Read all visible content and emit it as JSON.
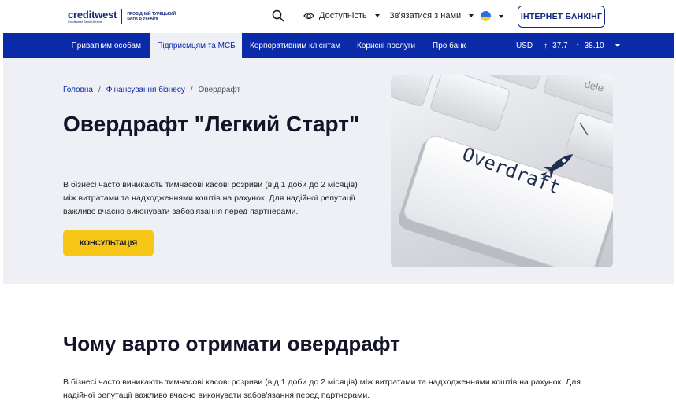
{
  "header": {
    "logo_word": "creditwest",
    "logo_sub": "Creditwest Bank Ukraine",
    "logo_tagline": "ПРОВІДНИЙ ТУРЕЦЬКИЙ БАНК В УКРАЇНІ",
    "accessibility_label": "Доступність",
    "contact_label": "Зв'язатися з нами",
    "internet_banking_label": "ІНТЕРНЕТ БАНКІНГ"
  },
  "nav": {
    "items": [
      {
        "label": "Приватним особам"
      },
      {
        "label": "Підприємцям та МСБ"
      },
      {
        "label": "Корпоративним клієнтам"
      },
      {
        "label": "Корисні послуги"
      },
      {
        "label": "Про банк"
      }
    ],
    "active_index": 1,
    "currency": "USD",
    "rate_buy": "37.7",
    "rate_sell": "38.10"
  },
  "breadcrumb": {
    "home": "Головна",
    "section": "Фінансування бізнесу",
    "current": "Овердрафт"
  },
  "hero": {
    "title": "Овердрафт \"Легкий Старт\"",
    "text": "В бізнесі часто виникають тимчасові касові розриви (від 1 доби до 2 місяців) між витратами та надходженнями коштів на рахунок. Для надійної репутації важливо вчасно виконувати забов'язання перед партнерами.",
    "button_label": "КОНСУЛЬТАЦІЯ",
    "image_key_text": "Overdraft",
    "image_corner_text": "dele"
  },
  "section": {
    "title": "Чому варто отримати овердрафт",
    "text": "В бізнесі часто виникають тимчасові касові розриви (від 1 доби до 2 місяців) між витратами та надходженнями коштів на рахунок. Для надійної репутації важливо вчасно виконувати забов'язання перед партнерами."
  },
  "colors": {
    "brand_blue": "#0a2aa8",
    "accent_yellow": "#f7c717",
    "hero_bg": "#eef0f6"
  }
}
